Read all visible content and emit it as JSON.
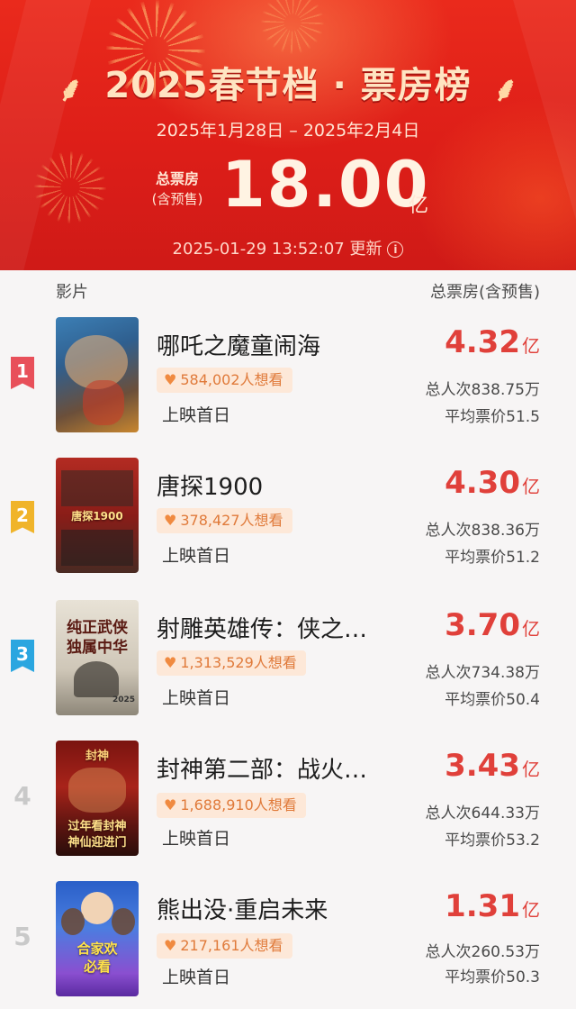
{
  "header": {
    "title": "2025春节档 · 票房榜",
    "date_range": "2025年1月28日 – 2025年2月4日",
    "total_label_1": "总票房",
    "total_label_2": "(含预售)",
    "total_value": "18.00",
    "total_unit": "亿",
    "update_time": "2025-01-29 13:52:07 更新",
    "info_icon": "i"
  },
  "columns": {
    "film": "影片",
    "box_office": "总票房(含预售)"
  },
  "colors": {
    "header_red": "#dd1e18",
    "gross_red": "#e0403a",
    "rank1": "#e8505a",
    "rank2": "#f0b42a",
    "rank3": "#2aa6e0"
  },
  "movies": [
    {
      "rank": "1",
      "name": "哪吒之魔童闹海",
      "want": "584,002人想看",
      "release": "上映首日",
      "gross": "4.32",
      "unit": "亿",
      "admissions": "总人次838.75万",
      "avg_price": "平均票价51.5"
    },
    {
      "rank": "2",
      "name": "唐探1900",
      "want": "378,427人想看",
      "release": "上映首日",
      "gross": "4.30",
      "unit": "亿",
      "admissions": "总人次838.36万",
      "avg_price": "平均票价51.2"
    },
    {
      "rank": "3",
      "name": "射雕英雄传：侠之…",
      "want": "1,313,529人想看",
      "release": "上映首日",
      "gross": "3.70",
      "unit": "亿",
      "admissions": "总人次734.38万",
      "avg_price": "平均票价50.4"
    },
    {
      "rank": "4",
      "name": "封神第二部：战火…",
      "want": "1,688,910人想看",
      "release": "上映首日",
      "gross": "3.43",
      "unit": "亿",
      "admissions": "总人次644.33万",
      "avg_price": "平均票价53.2"
    },
    {
      "rank": "5",
      "name": "熊出没·重启未来",
      "want": "217,161人想看",
      "release": "上映首日",
      "gross": "1.31",
      "unit": "亿",
      "admissions": "总人次260.53万",
      "avg_price": "平均票价50.3"
    }
  ],
  "poster_text": {
    "p2": "唐探1900",
    "p3_line1": "纯正武侠",
    "p3_line2": "独属中华",
    "p3_year": "2025",
    "p4_top": "封神",
    "p4_line1": "过年看封神",
    "p4_line2": "神仙迎进门",
    "p5_line1": "合家欢",
    "p5_line2": "必看"
  }
}
